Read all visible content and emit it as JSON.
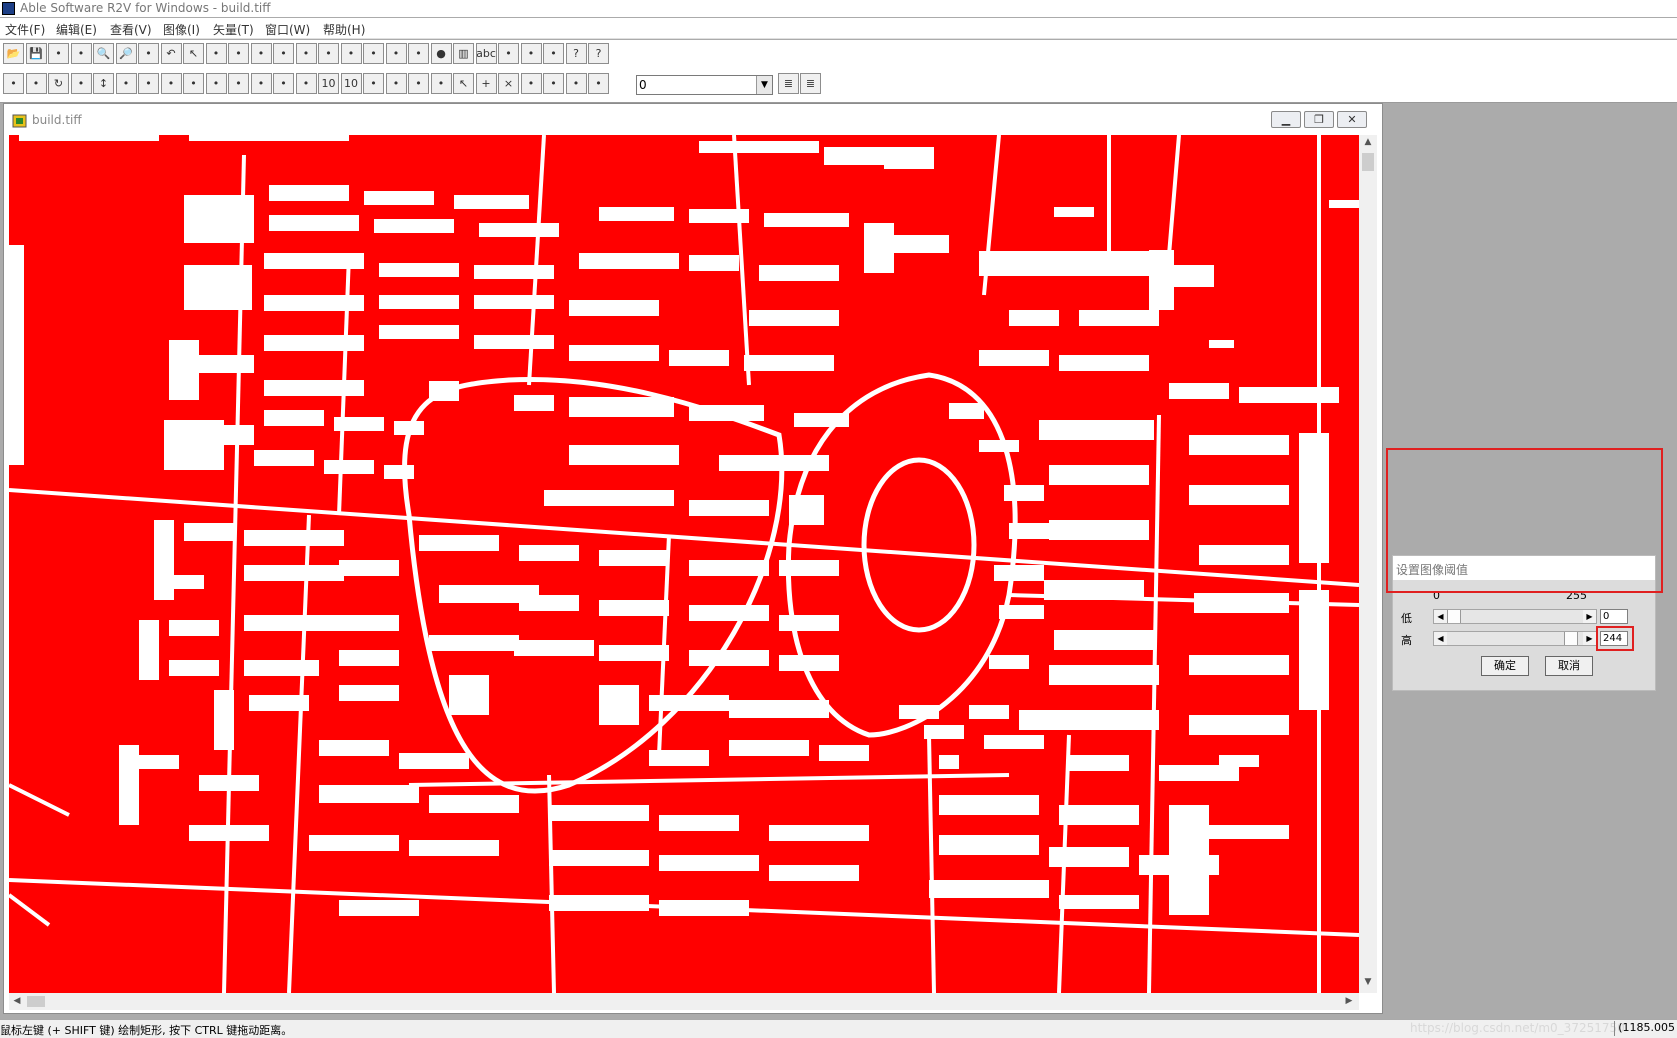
{
  "window": {
    "title": "Able Software R2V for Windows - build.tiff"
  },
  "menu": [
    "文件(F)",
    "编辑(E)",
    "查看(V)",
    "图像(I)",
    "矢量(T)",
    "窗口(W)",
    "帮助(H)"
  ],
  "toolbar": {
    "row1": [
      "open-icon",
      "save-icon",
      "save-all-icon",
      "export-icon",
      "zoom-in-icon",
      "zoom-out-icon",
      "trace-icon",
      "undo-icon",
      "select-icon",
      "fit-window-icon",
      "fit-width-icon",
      "image-view-icon",
      "frame-icon",
      "green-layer-icon",
      "node-icon",
      "node-line-icon",
      "split-icon",
      "snap-icon",
      "node-delete-icon",
      "stop-icon",
      "label-icon",
      "abc-icon",
      "center-icon",
      "pick-icon",
      "compare-icon",
      "help-icon",
      "context-help-icon"
    ],
    "row2": [
      "edit-node-icon",
      "draw-line-icon",
      "rotate-icon",
      "curve-icon",
      "vertical-icon",
      "split-v-icon",
      "diagonal-icon",
      "diagonal2-icon",
      "grid-icon",
      "corner-icon",
      "rect-icon",
      "line-tool-icon",
      "cross-icon",
      "link-icon",
      "num-icon",
      "num2-icon",
      "hatch-icon",
      "hatch2-icon",
      "fill-icon",
      "node-vert-icon",
      "arrow-select-icon",
      "add-point-icon",
      "cross-remove-icon",
      "move-point-icon",
      "align-icon",
      "label-node-icon",
      "snap-point-icon"
    ],
    "layer_value": "0"
  },
  "document": {
    "title": "build.tiff"
  },
  "status": {
    "text": "鼠标左键 (+ SHIFT 键) 绘制矩形, 按下 CTRL 键拖动距离。",
    "coords": "(1185.005",
    "watermark": "https://blog.csdn.net/m0_37251750"
  },
  "dialog": {
    "title": "设置图像阈值",
    "scale_min": "0",
    "scale_max": "255",
    "low_label": "低",
    "high_label": "高",
    "low_value": "0",
    "high_value": "244",
    "low_fraction": 0.0,
    "high_fraction": 0.957,
    "ok_label": "确定",
    "cancel_label": "取消"
  },
  "colors": {
    "canvas_background": "#ff0000",
    "foreground": "#ffffff",
    "highlight_box": "#e02020"
  }
}
